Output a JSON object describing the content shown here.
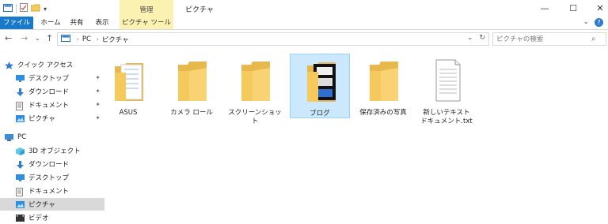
{
  "window": {
    "title": "ピクチャ",
    "context_group": "管理",
    "minimize": "—",
    "maximize": "☐",
    "close": "✕"
  },
  "ribbon": {
    "tabs": [
      "ファイル",
      "ホーム",
      "共有",
      "表示",
      "ピクチャ ツール"
    ]
  },
  "address": {
    "crumbs": [
      "PC",
      "ピクチャ"
    ]
  },
  "search": {
    "placeholder": "ピクチャの検索"
  },
  "navpane": {
    "items": [
      {
        "label": "クイック アクセス",
        "icon": "star-icon",
        "pinned": false
      },
      {
        "label": "デスクトップ",
        "icon": "desktop-icon",
        "pinned": true
      },
      {
        "label": "ダウンロード",
        "icon": "download-icon",
        "pinned": true
      },
      {
        "label": "ドキュメント",
        "icon": "document-icon",
        "pinned": true
      },
      {
        "label": "ピクチャ",
        "icon": "pictures-icon",
        "pinned": true
      },
      {
        "label": "PC",
        "icon": "pc-icon",
        "pinned": false
      },
      {
        "label": "3D オブジェクト",
        "icon": "3d-objects-icon",
        "pinned": false
      },
      {
        "label": "ダウンロード",
        "icon": "download-icon",
        "pinned": false
      },
      {
        "label": "デスクトップ",
        "icon": "desktop-icon",
        "pinned": false
      },
      {
        "label": "ドキュメント",
        "icon": "document-icon",
        "pinned": false
      },
      {
        "label": "ピクチャ",
        "icon": "pictures-icon",
        "pinned": false
      },
      {
        "label": "ビデオ",
        "icon": "video-icon",
        "pinned": false
      }
    ]
  },
  "content": {
    "items": [
      {
        "label": "ASUS",
        "type": "folder-with-documents"
      },
      {
        "label": "カメラ ロール",
        "type": "folder"
      },
      {
        "label": "スクリーンショット",
        "type": "folder"
      },
      {
        "label": "ブログ",
        "type": "folder-with-images",
        "selected": true
      },
      {
        "label": "保存済みの写真",
        "type": "folder"
      },
      {
        "label": "新しいテキスト ドキュメント.txt",
        "type": "text-file"
      }
    ]
  },
  "colors": {
    "file_tab": "#1979ca",
    "context_tab": "#fbf1b0",
    "selection": "#cce8ff",
    "folder": "#f5c95b"
  }
}
